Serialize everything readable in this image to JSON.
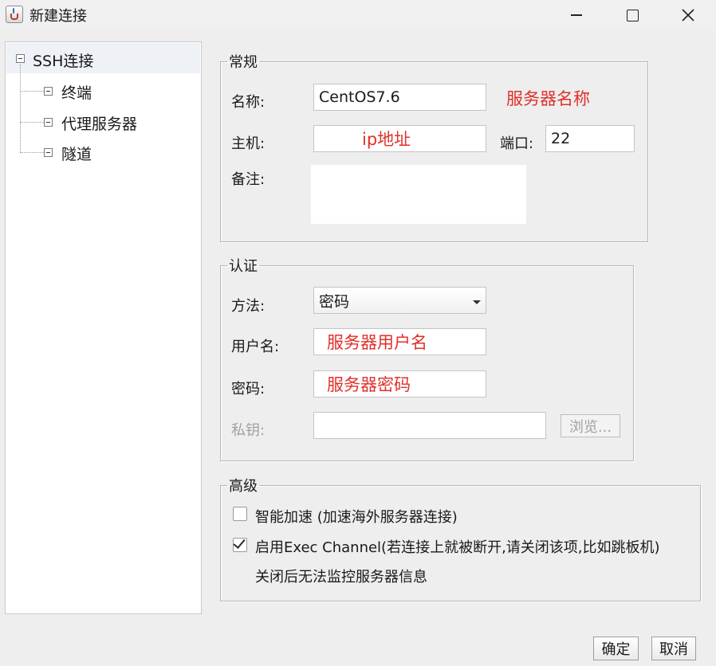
{
  "window": {
    "title": "新建连接"
  },
  "tree": {
    "root": "SSH连接",
    "children": [
      "终端",
      "代理服务器",
      "隧道"
    ]
  },
  "general": {
    "legend": "常规",
    "name_label": "名称:",
    "name_value": "CentOS7.6",
    "name_hint": "服务器名称",
    "host_label": "主机:",
    "host_hint": "ip地址",
    "port_label": "端口:",
    "port_value": "22",
    "note_label": "备注:",
    "note_value": ""
  },
  "auth": {
    "legend": "认证",
    "method_label": "方法:",
    "method_value": "密码",
    "username_label": "用户名:",
    "username_hint": "服务器用户名",
    "password_label": "密码:",
    "password_hint": "服务器密码",
    "key_label": "私钥:",
    "key_value": "",
    "browse_label": "浏览..."
  },
  "advanced": {
    "legend": "高级",
    "accel_label": "智能加速 (加速海外服务器连接)",
    "accel_checked": false,
    "exec_label": "启用Exec Channel(若连接上就被断开,请关闭该项,比如跳板机)",
    "exec_checked": true,
    "exec_note": "关闭后无法监控服务器信息"
  },
  "footer": {
    "ok_label": "确定",
    "cancel_label": "取消"
  },
  "colors": {
    "hint": "#e0302a",
    "disabled": "#a2a2a2",
    "background": "#eeeeee"
  },
  "icons": [
    "java-app-icon",
    "minimize-icon",
    "maximize-icon",
    "close-icon",
    "tree-collapse-icon",
    "dropdown-arrow-icon",
    "checkmark-icon"
  ]
}
